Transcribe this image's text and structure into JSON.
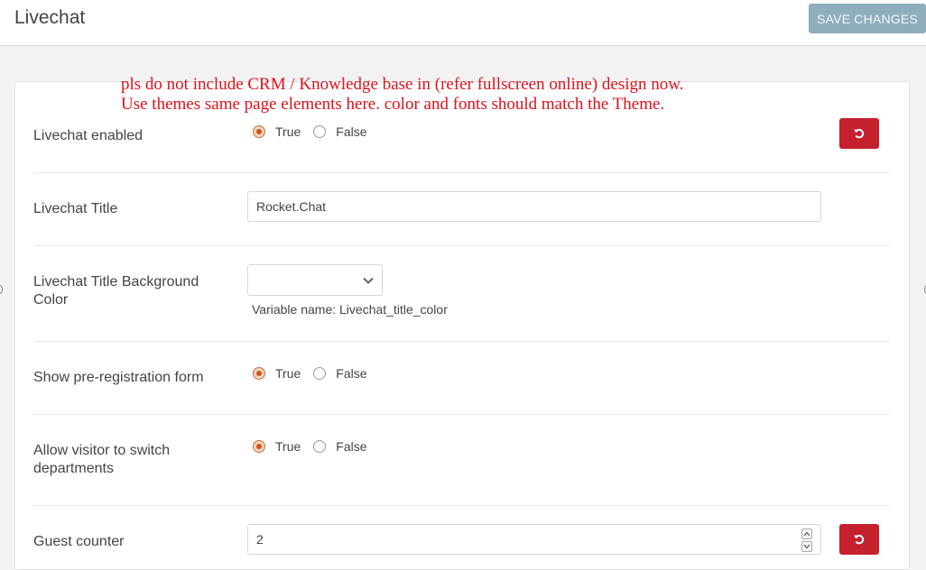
{
  "header": {
    "title": "Livechat",
    "save_label": "SAVE CHANGES"
  },
  "annotation": {
    "line1": "pls do not include CRM  / Knowledge base in (refer fullscreen online) design now.",
    "line2": "Use themes same page elements here. color and fonts should match the Theme.",
    "color": "#e0101a"
  },
  "settings": {
    "livechat_enabled": {
      "label": "Livechat enabled",
      "true_label": "True",
      "false_label": "False",
      "selected": "True"
    },
    "livechat_title": {
      "label": "Livechat Title",
      "value": "Rocket.Chat"
    },
    "title_bg_color": {
      "label_line1": "Livechat Title Background",
      "label_line2": "Color",
      "value": "",
      "hint": "Variable name: Livechat_title_color"
    },
    "show_preregistration": {
      "label": "Show pre-registration form",
      "true_label": "True",
      "false_label": "False",
      "selected": "True"
    },
    "allow_switch_departments": {
      "label_line1": "Allow visitor to switch",
      "label_line2": "departments",
      "true_label": "True",
      "false_label": "False",
      "selected": "True"
    },
    "guest_counter": {
      "label": "Guest counter",
      "value": "2"
    }
  },
  "colors": {
    "save_button": "#8eaebd",
    "reset_button": "#c4202d",
    "radio_selected": "#d2531b"
  },
  "icons": {
    "reset": "undo-icon",
    "dropdown": "chevron-down-icon",
    "spinner_up": "chevron-up-icon",
    "spinner_down": "chevron-down-icon"
  }
}
